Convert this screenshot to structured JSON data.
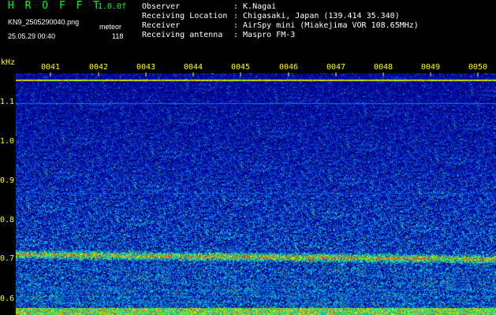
{
  "header": {
    "app_name": "H R O F F T",
    "version": "1.0.0f",
    "filename": "KN9_2505290040.png",
    "mode": "meteor",
    "datetime": "25.05.29 00:40",
    "count": "118",
    "observer_label": "Observer",
    "observer_value": ": K.Nagai",
    "location_label": "Receiving Location",
    "location_value": ": Chigasaki, Japan (139.414 35.340)",
    "receiver_label": "Receiver",
    "receiver_value": ": AirSpy mini (Miakejima VOR 108.65MHz)",
    "antenna_label": "Receiving antenna",
    "antenna_value": ": Maspro FM-3"
  },
  "axes": {
    "y_unit": "kHz",
    "x_ticks": [
      "0041",
      "0042",
      "0043",
      "0044",
      "0045",
      "0046",
      "0047",
      "0048",
      "0049",
      "0050"
    ],
    "y_ticks": [
      "1.1",
      "1.0",
      "0.9",
      "0.8",
      "0.7",
      "0.6"
    ]
  },
  "colors": {
    "bg": "#000000",
    "label": "#ffff00",
    "title": "#00ff00",
    "info": "#ffffff"
  }
}
